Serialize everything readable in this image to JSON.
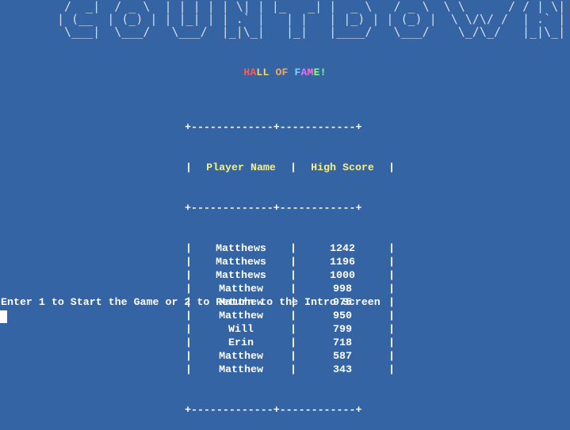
{
  "banner": {
    "word": "COUNTDOWN",
    "art": " /  _|  / _ \\  | | | | | \\| | |_   _| |  _ \\   / _ \\  \\ \\      / / | \\| |\n| (__  | (_) | | |_| | | .` |   | |   | |_) | | (_) |  \\ \\/\\/ /  | .` |\n \\___|  \\___/   \\___/  |_|\\_|   |_|   |____/   \\___/    \\_/\\_/   |_|\\_|"
  },
  "hall_of_fame": {
    "letters": [
      "H",
      "A",
      "L",
      "L",
      " ",
      "O",
      "F",
      " ",
      "F",
      "A",
      "M",
      "E",
      "!"
    ],
    "colors": [
      "#ff5a5a",
      "#ff5a5a",
      "#ffd84a",
      "#ffd84a",
      "#ffd84a",
      "#ffa84a",
      "#ffa84a",
      "#ffffff",
      "#7ad0ff",
      "#d27aff",
      "#ff6fcf",
      "#7dff7d",
      "#7dff7d"
    ]
  },
  "table": {
    "border_line": "+-------------+------------+",
    "headers": [
      "Player Name",
      "High Score"
    ],
    "rows": [
      {
        "name": "Matthews",
        "score": "1242"
      },
      {
        "name": "Matthews",
        "score": "1196"
      },
      {
        "name": "Matthews",
        "score": "1000"
      },
      {
        "name": "Matthew",
        "score": "998"
      },
      {
        "name": "Matthew",
        "score": "975"
      },
      {
        "name": "Matthew",
        "score": "950"
      },
      {
        "name": "Will",
        "score": "799"
      },
      {
        "name": "Erin",
        "score": "718"
      },
      {
        "name": "Matthew",
        "score": "587"
      },
      {
        "name": "Matthew",
        "score": "343"
      }
    ]
  },
  "prompt": {
    "text": "Enter 1 to Start the Game or 2 to Return to the Intro Screen"
  },
  "colors": {
    "background": "#3464a4",
    "header_text": "#f4f08a",
    "text": "#ffffff"
  }
}
